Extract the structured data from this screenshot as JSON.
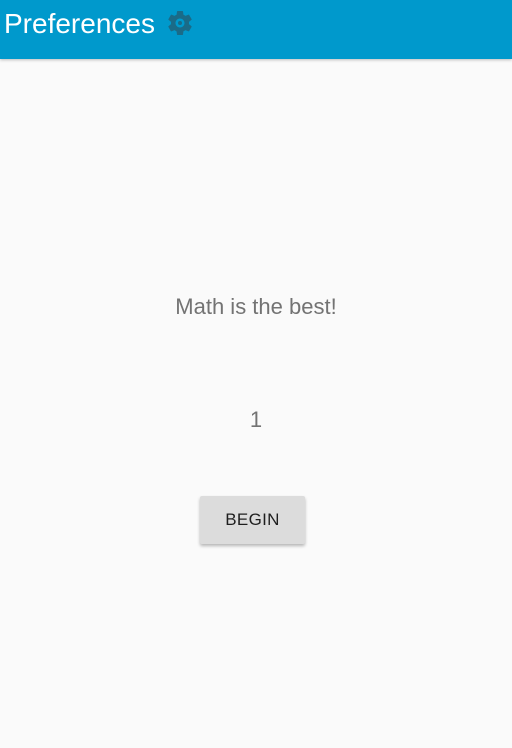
{
  "app_bar": {
    "title": "Preferences",
    "settings_icon": "gear-icon",
    "background_color": "#0099cc",
    "icon_color": "#1a6b88"
  },
  "main": {
    "message": "Math is the best!",
    "counter": "1",
    "begin_label": "BEGIN"
  }
}
